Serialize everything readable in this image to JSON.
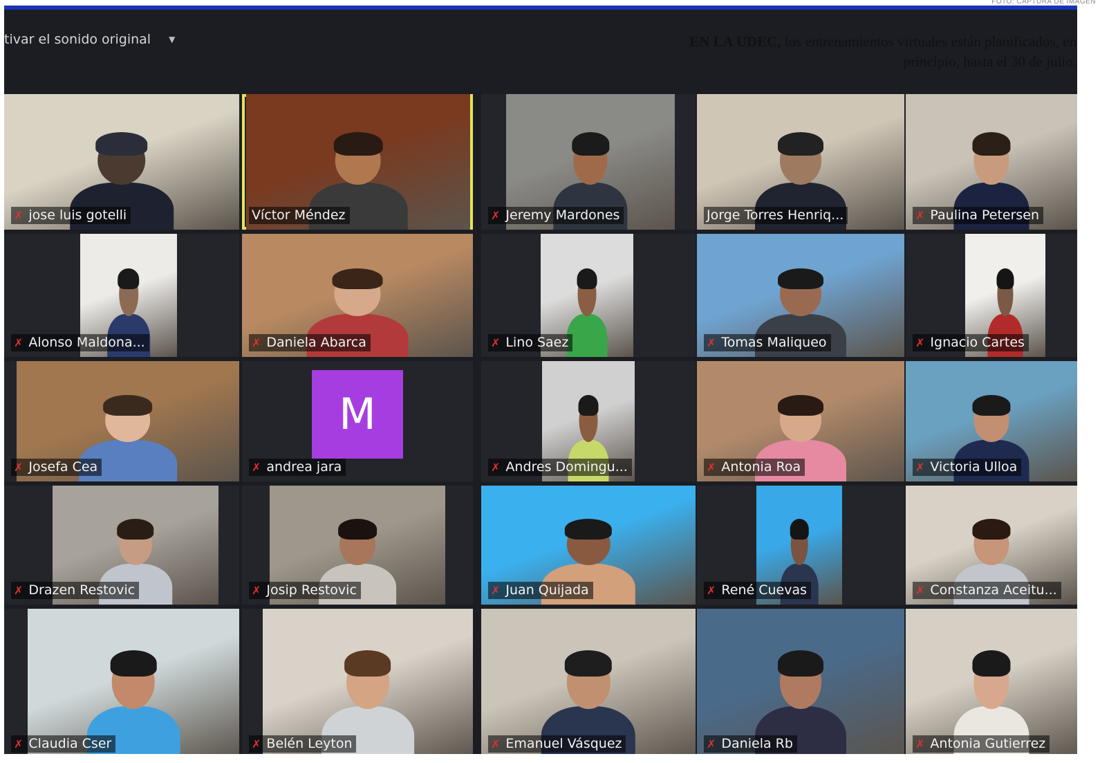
{
  "photo_credit": "FOTO: CAPTURA DE IMAGEN",
  "topbar": {
    "text": "tivar el sonido original",
    "chevron_icon": "chevron-down-icon"
  },
  "caption": {
    "bold": "EN LA UDEC,",
    "text": " los entrenamientos virtuales están planificados, en principio, hasta el 30 de julio."
  },
  "colors": {
    "mic_muted": "#e0312f",
    "active_speaker_border": "#e3e35a",
    "avatar_bg": "#a53de0",
    "window_top": "#1a33b8"
  },
  "participants": [
    {
      "name": "jose luis gotelli",
      "muted": true
    },
    {
      "name": "Víctor Méndez",
      "muted": false,
      "active": true
    },
    {
      "name": "Jeremy Mardones",
      "muted": true
    },
    {
      "name": "Jorge Torres Henriq...",
      "muted": false
    },
    {
      "name": "Paulina Petersen",
      "muted": true
    },
    {
      "name": "Alonso Maldona...",
      "muted": true
    },
    {
      "name": "Daniela Abarca",
      "muted": true
    },
    {
      "name": "Lino Saez",
      "muted": true
    },
    {
      "name": "Tomas Maliqueo",
      "muted": true
    },
    {
      "name": "Ignacio Cartes",
      "muted": true
    },
    {
      "name": "Josefa Cea",
      "muted": true
    },
    {
      "name": "andrea jara",
      "muted": true,
      "avatar_letter": "M"
    },
    {
      "name": "Andres Domingu...",
      "muted": true
    },
    {
      "name": "Antonia Roa",
      "muted": true
    },
    {
      "name": "Victoria Ulloa",
      "muted": true
    },
    {
      "name": "Drazen Restovic",
      "muted": true
    },
    {
      "name": "Josip Restovic",
      "muted": true
    },
    {
      "name": "Juan Quijada",
      "muted": true
    },
    {
      "name": "René Cuevas",
      "muted": true
    },
    {
      "name": "Constanza Aceitu...",
      "muted": true
    },
    {
      "name": "Claudia Cser",
      "muted": true
    },
    {
      "name": "Belén Leyton",
      "muted": true
    },
    {
      "name": "Emanuel Vásquez",
      "muted": true
    },
    {
      "name": "Daniela Rb",
      "muted": true
    },
    {
      "name": "Antonia Gutierrez",
      "muted": true
    }
  ]
}
